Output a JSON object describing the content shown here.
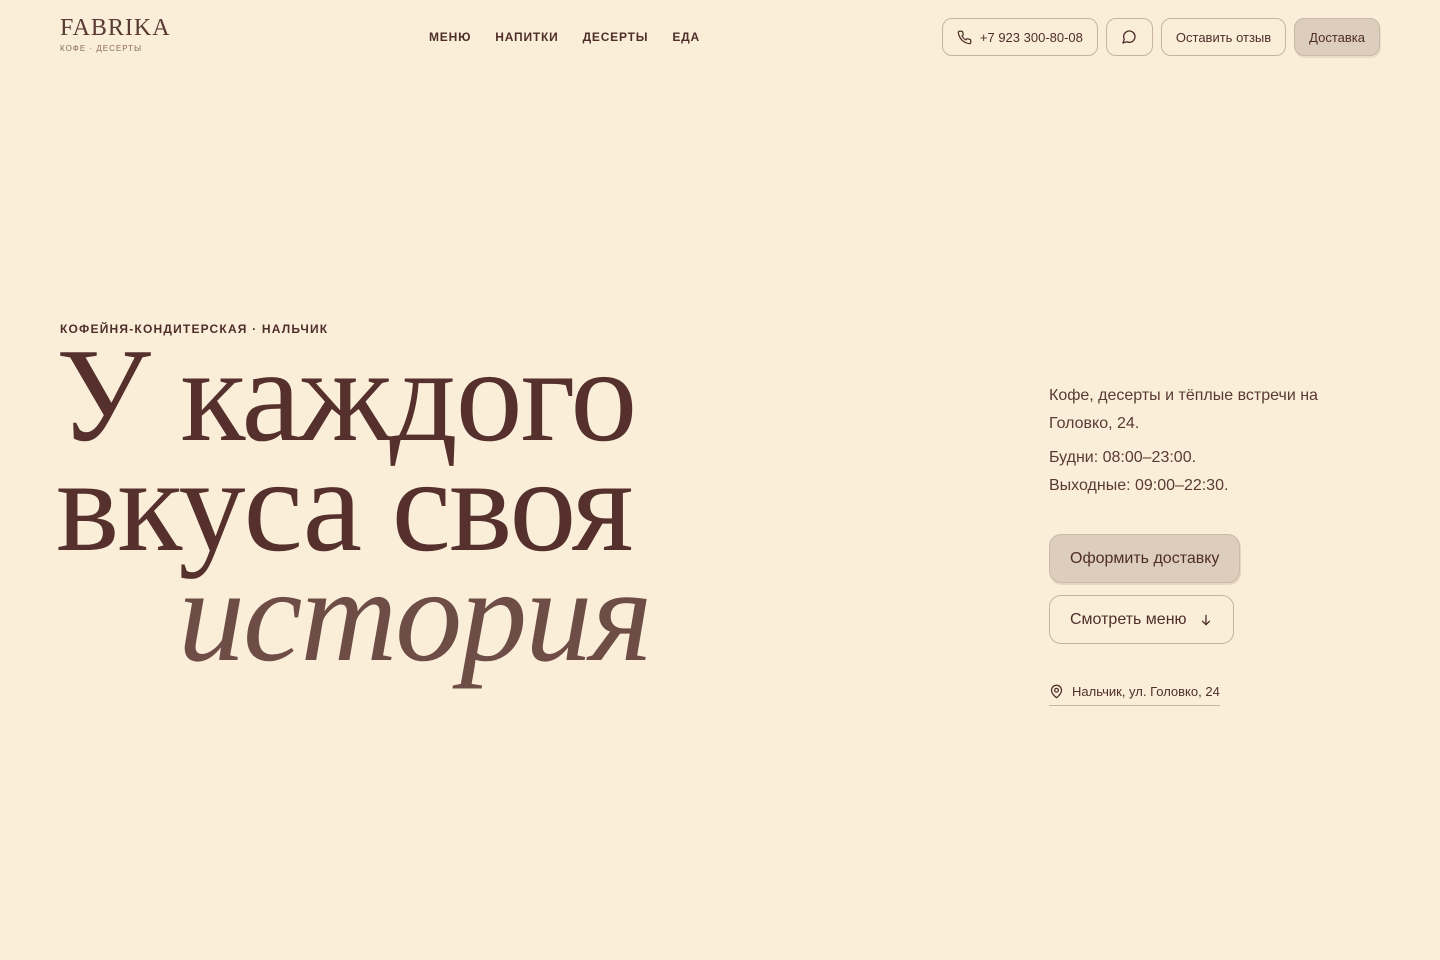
{
  "brand": {
    "name": "FABRIKA",
    "tagline": "КОФЕ · ДЕСЕРТЫ"
  },
  "nav": {
    "items": [
      {
        "label": "МЕНЮ"
      },
      {
        "label": "НАПИТКИ"
      },
      {
        "label": "ДЕСЕРТЫ"
      },
      {
        "label": "ЕДА"
      }
    ]
  },
  "header": {
    "phone": "+7 923 300-80-08",
    "review_label": "Оставить отзыв",
    "delivery_label": "Доставка"
  },
  "hero": {
    "eyebrow": "КОФЕЙНЯ-КОНДИТЕРСКАЯ · НАЛЬЧИК",
    "headline_line1": "У каждого",
    "headline_line2": "вкуса своя",
    "headline_line3": "история",
    "description": "Кофе, десерты и тёплые встречи на Головко, 24.",
    "weekday_hours": "Будни: 08:00–23:00.",
    "weekend_hours": "Выходные: 09:00–22:30.",
    "primary_cta": "Оформить доставку",
    "secondary_cta": "Смотреть меню",
    "address": "Нальчик, ул. Головко, 24"
  },
  "icons": {
    "phone": "phone-icon",
    "chat": "chat-bubble-icon",
    "arrow": "arrow-down-icon",
    "pin": "map-pin-icon"
  },
  "colors": {
    "background": "#faeed9",
    "text": "#4f2e2a",
    "accent_button": "#dccdbc",
    "italic_text": "#6f4d47"
  }
}
